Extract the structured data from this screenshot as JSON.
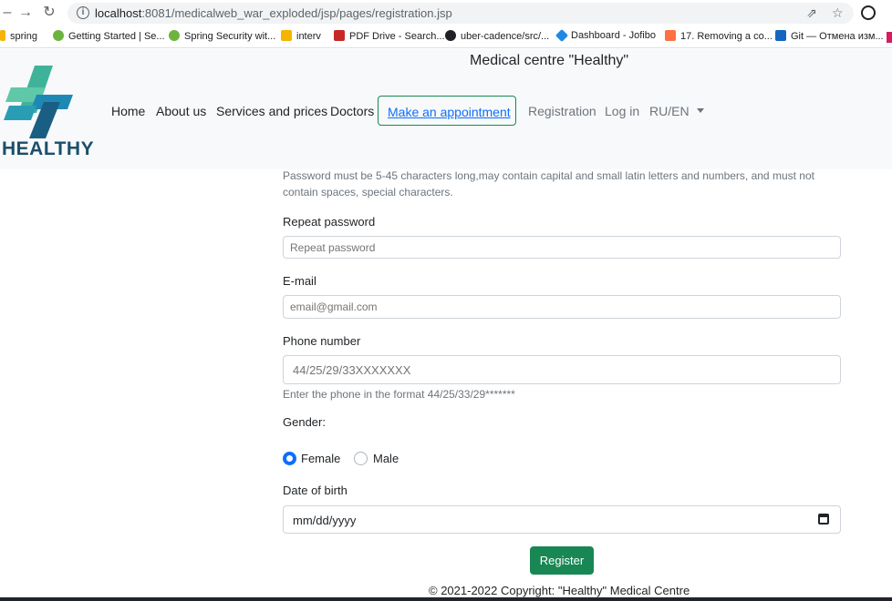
{
  "browser": {
    "url_host": "localhost",
    "url_rest": ":8081/medicalweb_war_exploded/jsp/pages/registration.jsp",
    "bookmarks": [
      {
        "label": "spring",
        "color": "#f4b400"
      },
      {
        "label": "Getting Started | Se...",
        "color": "#6db33f"
      },
      {
        "label": "Spring Security wit...",
        "color": "#6db33f"
      },
      {
        "label": "interv",
        "color": "#f4b400"
      },
      {
        "label": "PDF Drive - Search...",
        "color": "#c62828"
      },
      {
        "label": "uber-cadence/src/...",
        "color": "#202124"
      },
      {
        "label": "Dashboard - Jofibo",
        "color": "#1e88e5"
      },
      {
        "label": "17. Removing a co...",
        "color": "#ff7043"
      },
      {
        "label": "Git — Отмена изм...",
        "color": "#1565c0"
      }
    ]
  },
  "site": {
    "title": "Medical centre \"Healthy\"",
    "logo_text": "HEALTHY",
    "nav": {
      "home": "Home",
      "about": "About us",
      "services": "Services and prices",
      "doctors": "Doctors",
      "appointment": "Make an appointment",
      "registration": "Registration",
      "login": "Log in",
      "lang": "RU/EN"
    }
  },
  "form": {
    "password_help": "Password must be 5-45 characters long,may contain capital and small latin letters and numbers, and must not contain spaces, special characters.",
    "repeat_password_label": "Repeat password",
    "repeat_password_placeholder": "Repeat password",
    "email_label": "E-mail",
    "email_placeholder": "email@gmail.com",
    "phone_label": "Phone number",
    "phone_placeholder": "44/25/29/33XXXXXXX",
    "phone_help": "Enter the phone in the format 44/25/33/29*******",
    "gender_label": "Gender:",
    "gender_female": "Female",
    "gender_male": "Male",
    "gender_selected": "Female",
    "dob_label": "Date of birth",
    "dob_placeholder": "mm/dd/yyyy",
    "register_label": "Register"
  },
  "footer": {
    "copyright": "© 2021-2022 Copyright: \"Healthy\" Medical Centre"
  },
  "colors": {
    "accent_green": "#198754",
    "link_blue": "#0d6efd",
    "logo_dark": "#1b4f6b"
  }
}
